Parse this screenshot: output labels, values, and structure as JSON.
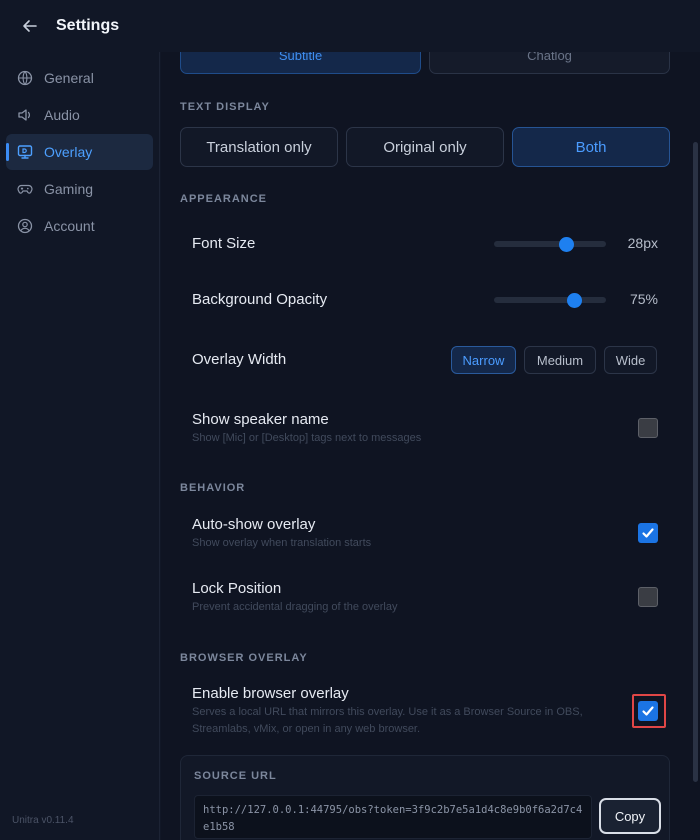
{
  "header": {
    "title": "Settings",
    "back_icon": "arrow-left-icon"
  },
  "sidebar": {
    "items": [
      {
        "label": "General",
        "icon": "globe-icon",
        "active": false
      },
      {
        "label": "Audio",
        "icon": "speaker-icon",
        "active": false
      },
      {
        "label": "Overlay",
        "icon": "monitor-icon",
        "active": true
      },
      {
        "label": "Gaming",
        "icon": "gamepad-icon",
        "active": false
      },
      {
        "label": "Account",
        "icon": "user-circle-icon",
        "active": false
      }
    ],
    "version": "Unitra v0.11.4"
  },
  "mode_tabs": {
    "subtitle": "Subtitle",
    "chatlog": "Chatlog",
    "selected": "Subtitle"
  },
  "text_display": {
    "section": "TEXT DISPLAY",
    "options": [
      "Translation only",
      "Original only",
      "Both"
    ],
    "selected": "Both"
  },
  "appearance": {
    "section": "APPEARANCE",
    "font_size": {
      "label": "Font Size",
      "value_text": "28px",
      "level": 0.65
    },
    "background_opacity": {
      "label": "Background Opacity",
      "value_text": "75%",
      "level": 0.72
    },
    "overlay_width": {
      "label": "Overlay Width",
      "options": [
        "Narrow",
        "Medium",
        "Wide"
      ],
      "selected": "Narrow"
    },
    "show_speaker": {
      "label": "Show speaker name",
      "description": "Show [Mic] or [Desktop] tags next to messages",
      "checked": false
    }
  },
  "behavior": {
    "section": "BEHAVIOR",
    "auto_show": {
      "label": "Auto-show overlay",
      "description": "Show overlay when translation starts",
      "checked": true
    },
    "lock_position": {
      "label": "Lock Position",
      "description": "Prevent accidental dragging of the overlay",
      "checked": false
    }
  },
  "browser_overlay": {
    "section": "BROWSER OVERLAY",
    "enable": {
      "label": "Enable browser overlay",
      "description_line1": "Serves a local URL that mirrors this overlay. Use it as a Browser Source in OBS,",
      "description_line2": "Streamlabs, vMix, or open in any web browser.",
      "checked": true
    },
    "source_url_label": "SOURCE URL",
    "source_url": "http://127.0.0.1:44795/obs?token=3f9c2b7e5a1d4c8e9b0f6a2d7c4e1b58",
    "copy_label": "Copy"
  },
  "colors": {
    "accent": "#1b74e4",
    "background": "#0f1422",
    "highlight": "#e04646"
  }
}
